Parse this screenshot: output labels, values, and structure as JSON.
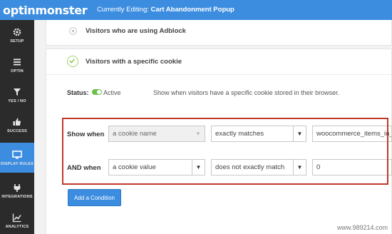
{
  "topbar": {
    "logo_text": "optinmonster",
    "editing_prefix": "Currently Editing:",
    "editing_name": "Cart Abandonment Popup"
  },
  "sidebar": {
    "items": [
      {
        "label": "SETUP",
        "icon": "gear-icon"
      },
      {
        "label": "OPTIN",
        "icon": "hamburger-icon"
      },
      {
        "label": "YES / NO",
        "icon": "filter-icon"
      },
      {
        "label": "SUCCESS",
        "icon": "thumbs-up-icon"
      },
      {
        "label": "DISPLAY RULES",
        "icon": "monitor-icon",
        "active": true
      },
      {
        "label": "INTEGRATIONS",
        "icon": "plug-icon"
      },
      {
        "label": "ANALYTICS",
        "icon": "line-chart-icon"
      }
    ]
  },
  "rules": {
    "adblock_label": "Visitors who are using Adblock",
    "cookie_label": "Visitors with a specific cookie",
    "status_label": "Status:",
    "status_value": "Active",
    "cookie_description": "Show when visitors have a specific cookie stored in their browser."
  },
  "conditions": {
    "row1": {
      "label": "Show when",
      "field": "a cookie name",
      "operator": "exactly matches",
      "value": "woocommerce_items_in_cart"
    },
    "row2": {
      "label": "AND when",
      "field": "a cookie value",
      "operator": "does not exactly match",
      "value": "0"
    },
    "caret": "▼"
  },
  "add_condition_label": "Add a Condition",
  "watermark": "www.989214.com",
  "colors": {
    "accent": "#3c8de0",
    "sidebar_bg": "#2b2b2b",
    "highlight": "#c0392b",
    "toggle_on": "#6cc04a"
  }
}
